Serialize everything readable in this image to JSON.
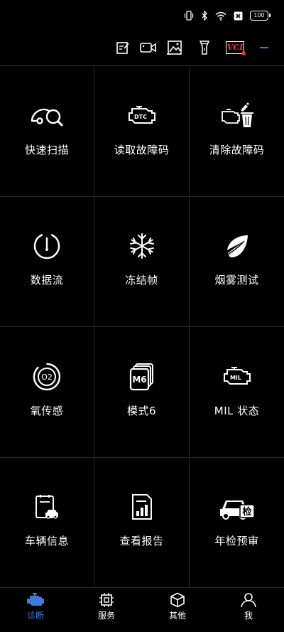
{
  "status": {
    "battery": "100"
  },
  "grid": [
    {
      "label": "快速扫描",
      "icon": "quick-scan-icon"
    },
    {
      "label": "读取故障码",
      "icon": "read-dtc-icon",
      "badge": "DTC"
    },
    {
      "label": "清除故障码",
      "icon": "clear-dtc-icon"
    },
    {
      "label": "数据流",
      "icon": "data-stream-gauge-icon"
    },
    {
      "label": "冻结帧",
      "icon": "freeze-frame-snowflake-icon"
    },
    {
      "label": "烟雾测试",
      "icon": "smoke-test-icon"
    },
    {
      "label": "氧传感",
      "icon": "oxygen-sensor-icon",
      "badge": "O2"
    },
    {
      "label": "模式6",
      "icon": "mode6-icon",
      "badge": "M6"
    },
    {
      "label": "MIL 状态",
      "icon": "mil-status-icon",
      "badge": "MIL"
    },
    {
      "label": "车辆信息",
      "icon": "vehicle-info-icon"
    },
    {
      "label": "查看报告",
      "icon": "view-report-icon"
    },
    {
      "label": "年检预审",
      "icon": "annual-inspection-icon",
      "badge": "检"
    }
  ],
  "toolbar": {
    "vci_label": "VCI"
  },
  "tabs": [
    {
      "label": "诊断",
      "icon": "engine-icon",
      "active": true
    },
    {
      "label": "服务",
      "icon": "chip-icon",
      "active": false
    },
    {
      "label": "其他",
      "icon": "cube-icon",
      "active": false
    },
    {
      "label": "我",
      "icon": "person-icon",
      "active": false
    }
  ],
  "colors": {
    "accent": "#3f7bd9",
    "background": "#000000",
    "divider": "#2a2a30",
    "vci": "#e53935"
  }
}
